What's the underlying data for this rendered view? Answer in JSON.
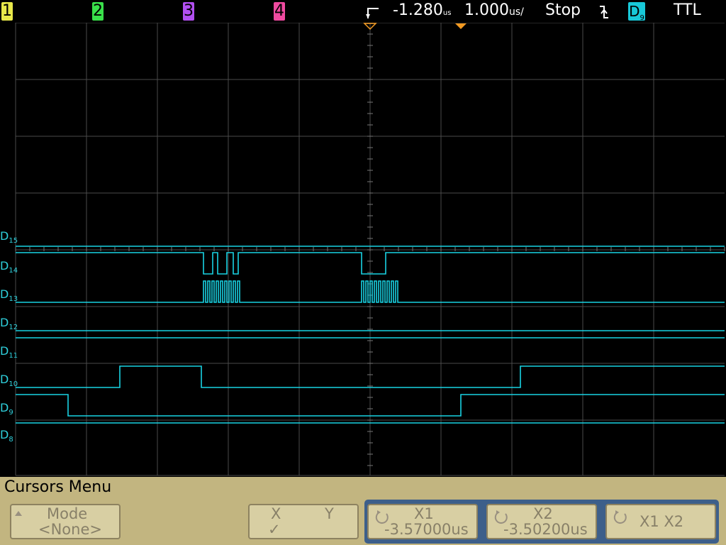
{
  "top_bar": {
    "channel_1": "1",
    "channel_2": "2",
    "channel_3": "3",
    "channel_4": "4",
    "delay": "-1.280",
    "delay_unit": "us",
    "timebase": "1.000",
    "timebase_unit": "us/",
    "run_state": "Stop",
    "trigger_slope_icon": "falling-edge-icon",
    "trigger_source_letter": "D",
    "trigger_source_sub": "9",
    "trigger_level": "TTL"
  },
  "digital_channels": [
    {
      "letter": "D",
      "num": "15"
    },
    {
      "letter": "D",
      "num": "14"
    },
    {
      "letter": "D",
      "num": "13"
    },
    {
      "letter": "D",
      "num": "12"
    },
    {
      "letter": "D",
      "num": "11"
    },
    {
      "letter": "D",
      "num": "10"
    },
    {
      "letter": "D",
      "num": "9"
    },
    {
      "letter": "D",
      "num": "8"
    }
  ],
  "menu": {
    "title": "Cursors Menu",
    "mode": {
      "label": "Mode",
      "value": "<None>"
    },
    "xy": {
      "x": "X",
      "y": "Y",
      "check": "✓"
    },
    "x1": {
      "label": "X1",
      "value": "-3.57000us"
    },
    "x2": {
      "label": "X2",
      "value": "-3.50200us"
    },
    "x1x2": {
      "label": "X1 X2"
    }
  },
  "colors": {
    "trace": "#19d3e3",
    "grid": "#4a4a4a",
    "background": "#000000",
    "menu_background": "#c2b580",
    "marker": "#f39a22"
  }
}
